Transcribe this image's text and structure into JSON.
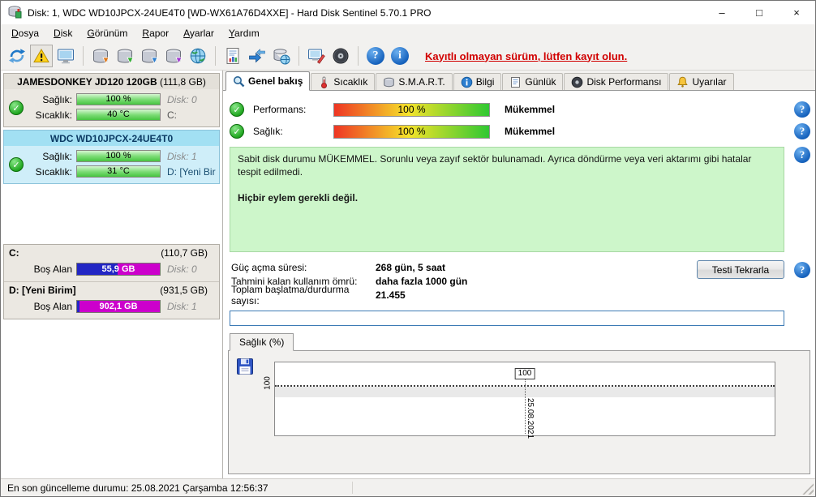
{
  "window": {
    "title": "Disk: 1, WDC WD10JPCX-24UE4T0 [WD-WX61A76D4XXE] - Hard Disk Sentinel 5.70.1 PRO"
  },
  "icons": {
    "check": "✓",
    "help": "?",
    "info": "i",
    "minimize": "–",
    "maximize": "□",
    "close": "×"
  },
  "menu": {
    "items": [
      "Dosya",
      "Disk",
      "Görünüm",
      "Rapor",
      "Ayarlar",
      "Yardım"
    ]
  },
  "toolbar": {
    "register_text": "Kayıtlı olmayan sürüm, lütfen kayıt olun."
  },
  "sidebar": {
    "disks": [
      {
        "name": "JAMESDONKEY JD120 120GB",
        "size": "(111,8 GB)",
        "health_label": "Sağlık:",
        "health_value": "100 %",
        "disk_index": "Disk: 0",
        "temp_label": "Sıcaklık:",
        "temp_value": "40 °C",
        "drive": "C:"
      },
      {
        "name": "WDC WD10JPCX-24UE4T0",
        "health_label": "Sağlık:",
        "health_value": "100 %",
        "disk_index": "Disk: 1",
        "temp_label": "Sıcaklık:",
        "temp_value": "31 °C",
        "drive": "D: [Yeni Birim]"
      }
    ],
    "partitions": [
      {
        "name": "C:",
        "size": "(110,7 GB)",
        "free_label": "Boş Alan",
        "free_value": "55,9 GB",
        "disk_index": "Disk: 0"
      },
      {
        "name": "D: [Yeni Birim]",
        "size": "(931,5 GB)",
        "free_label": "Boş Alan",
        "free_value": "902,1 GB",
        "disk_index": "Disk: 1"
      }
    ]
  },
  "tabs": [
    {
      "label": "Genel bakış",
      "active": true
    },
    {
      "label": "Sıcaklık",
      "active": false
    },
    {
      "label": "S.M.A.R.T.",
      "active": false
    },
    {
      "label": "Bilgi",
      "active": false
    },
    {
      "label": "Günlük",
      "active": false
    },
    {
      "label": "Disk Performansı",
      "active": false
    },
    {
      "label": "Uyarılar",
      "active": false
    }
  ],
  "overview": {
    "performance_label": "Performans:",
    "performance_value": "100 %",
    "performance_rating": "Mükemmel",
    "health_label": "Sağlık:",
    "health_value": "100 %",
    "health_rating": "Mükemmel",
    "status_text": "Sabit disk durumu MÜKEMMEL. Sorunlu veya zayıf sektör bulunamadı. Ayrıca döndürme veya veri aktarımı gibi hatalar tespit edilmedi.",
    "action_text": "Hiçbir eylem gerekli değil.",
    "stats": [
      {
        "label": "Güç açma süresi:",
        "value": "268 gün, 5 saat"
      },
      {
        "label": "Tahmini kalan kullanım ömrü:",
        "value": "daha fazla 1000 gün"
      },
      {
        "label": "Toplam başlatma/durdurma sayısı:",
        "value": "21.455"
      }
    ],
    "retest_button": "Testi Tekrarla",
    "text_input_value": ""
  },
  "chart": {
    "tab_label": "Sağlık (%)",
    "y_tick": "100",
    "point_label": "100",
    "x_tick": "25.08.2021"
  },
  "chart_data": {
    "type": "line",
    "title": "Sağlık (%)",
    "x": [
      "25.08.2021"
    ],
    "series": [
      {
        "name": "Sağlık (%)",
        "values": [
          100
        ]
      }
    ],
    "ylim": [
      0,
      100
    ],
    "yticks": [
      100
    ],
    "point_labels": [
      "100"
    ],
    "legend": false
  },
  "statusbar": {
    "text": "En son güncelleme durumu: 25.08.2021 Çarşamba 12:56:37"
  }
}
